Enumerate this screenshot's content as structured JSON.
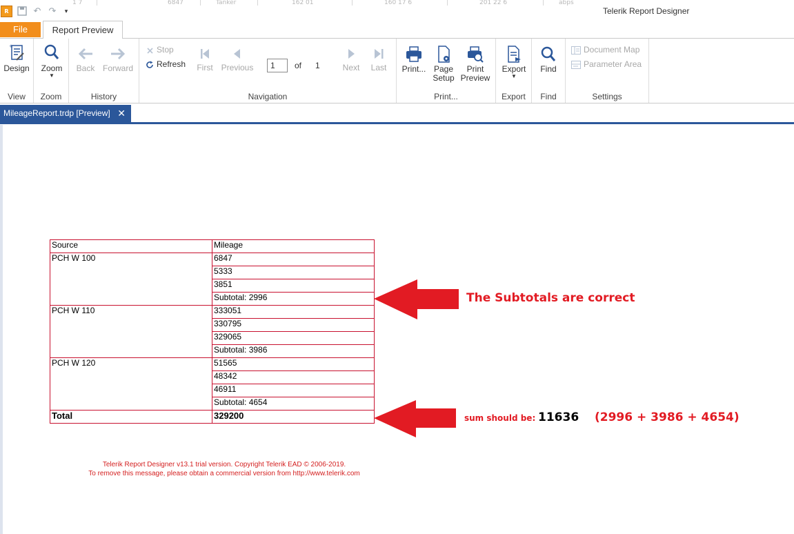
{
  "app": {
    "title": "Telerik Report Designer",
    "icon_label": "R",
    "background_cells": [
      "1 7",
      "6847",
      "Tanker",
      "162 01",
      "160 17 6",
      "201 22 6",
      "abps"
    ]
  },
  "menu": {
    "file_label": "File",
    "active_tab_label": "Report Preview"
  },
  "ribbon": {
    "view": {
      "group_label": "View",
      "design_label": "Design"
    },
    "zoom": {
      "group_label": "Zoom",
      "zoom_label": "Zoom"
    },
    "history": {
      "group_label": "History",
      "back_label": "Back",
      "forward_label": "Forward"
    },
    "navigation": {
      "group_label": "Navigation",
      "stop_label": "Stop",
      "refresh_label": "Refresh",
      "first_label": "First",
      "previous_label": "Previous",
      "current_page": "1",
      "of_label": "of",
      "total_pages": "1",
      "next_label": "Next",
      "last_label": "Last"
    },
    "print": {
      "group_label": "Print...",
      "print_label": "Print...",
      "page_setup_line1": "Page",
      "page_setup_line2": "Setup",
      "print_preview_line1": "Print",
      "print_preview_line2": "Preview"
    },
    "export": {
      "group_label": "Export",
      "export_label": "Export"
    },
    "find": {
      "group_label": "Find",
      "find_label": "Find"
    },
    "settings": {
      "group_label": "Settings",
      "document_map_label": "Document Map",
      "parameter_area_label": "Parameter Area"
    }
  },
  "document_tab": {
    "label": "MileageReport.trdp [Preview]",
    "close_glyph": "✕"
  },
  "report": {
    "headers": [
      "Source",
      "Mileage"
    ],
    "groups": [
      {
        "source": "PCH W 100",
        "values": [
          "6847",
          "5333",
          "3851"
        ],
        "subtotal": "Subtotal:  2996"
      },
      {
        "source": "PCH W 110",
        "values": [
          "333051",
          "330795",
          "329065"
        ],
        "subtotal": "Subtotal:  3986"
      },
      {
        "source": "PCH W 120",
        "values": [
          "51565",
          "48342",
          "46911"
        ],
        "subtotal": "Subtotal:  4654"
      }
    ],
    "total_label": "Total",
    "total_value": "329200"
  },
  "annotations": {
    "subtotals_correct": "The Subtotals are correct",
    "sum_label": "sum should be:",
    "sum_value": "11636",
    "sum_formula": "(2996 + 3986 + 4654)",
    "arrow_color": "#e21b23"
  },
  "trial_notice": {
    "line1": "Telerik Report Designer v13.1 trial version. Copyright Telerik EAD © 2006-2019.",
    "line2": "To remove this message, please obtain a commercial version from http://www.telerik.com"
  }
}
